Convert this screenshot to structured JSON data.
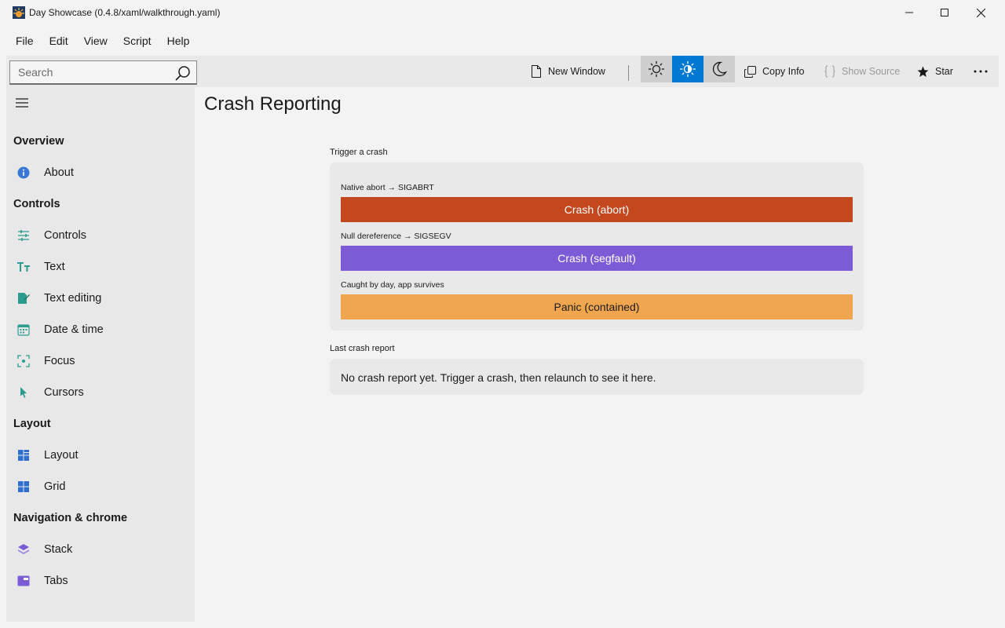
{
  "window": {
    "title": "Day Showcase (0.4.8/xaml/walkthrough.yaml)"
  },
  "menu": [
    "File",
    "Edit",
    "View",
    "Script",
    "Help"
  ],
  "search": {
    "placeholder": "Search"
  },
  "toolbar": {
    "new_window": "New Window",
    "copy_info": "Copy Info",
    "show_source": "Show Source",
    "star": "Star",
    "theme_selected": "auto"
  },
  "sidebar": {
    "sections": [
      {
        "header": "Overview",
        "items": [
          {
            "label": "About",
            "icon": "info-icon"
          }
        ]
      },
      {
        "header": "Controls",
        "items": [
          {
            "label": "Controls",
            "icon": "sliders-icon"
          },
          {
            "label": "Text",
            "icon": "text-size-icon"
          },
          {
            "label": "Text editing",
            "icon": "edit-document-icon"
          },
          {
            "label": "Date & time",
            "icon": "calendar-icon"
          },
          {
            "label": "Focus",
            "icon": "focus-icon"
          },
          {
            "label": "Cursors",
            "icon": "cursor-icon"
          }
        ]
      },
      {
        "header": "Layout",
        "items": [
          {
            "label": "Layout",
            "icon": "layout-grid-icon"
          },
          {
            "label": "Grid",
            "icon": "grid-icon"
          }
        ]
      },
      {
        "header": "Navigation & chrome",
        "items": [
          {
            "label": "Stack",
            "icon": "layers-icon"
          },
          {
            "label": "Tabs",
            "icon": "tabs-icon"
          }
        ]
      }
    ]
  },
  "main": {
    "title": "Crash Reporting",
    "trigger_label": "Trigger a crash",
    "buttons": [
      {
        "caption": "Native abort → SIGABRT",
        "label": "Crash (abort)"
      },
      {
        "caption": "Null dereference → SIGSEGV",
        "label": "Crash (segfault)"
      },
      {
        "caption": "Caught by day, app survives",
        "label": "Panic (contained)"
      }
    ],
    "report_label": "Last crash report",
    "report_text": "No crash report yet. Trigger a crash, then relaunch to see it here."
  },
  "colors": {
    "abort": "#c4471e",
    "segfault": "#7b5bd6",
    "panic": "#f0a64e",
    "accent": "#0078d4"
  }
}
